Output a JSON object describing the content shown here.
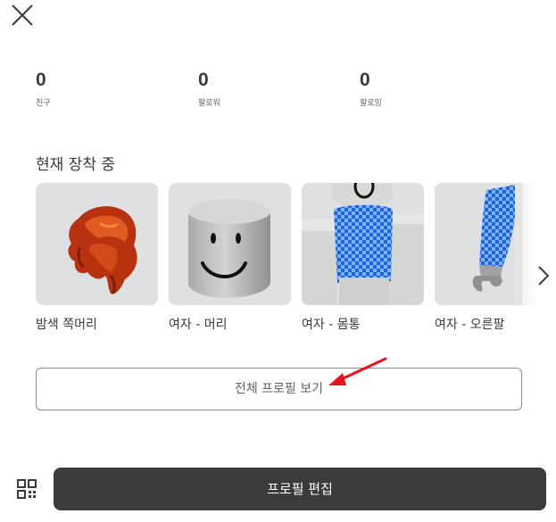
{
  "header": {
    "close_icon": "close-icon"
  },
  "stats": [
    {
      "value": "0",
      "label": "친구"
    },
    {
      "value": "0",
      "label": "팔로워"
    },
    {
      "value": "0",
      "label": "팔로잉"
    }
  ],
  "wearing": {
    "title": "현재 장착 중",
    "items": [
      {
        "name": "밤색 쪽머리",
        "icon": "hair-icon"
      },
      {
        "name": "여자 - 머리",
        "icon": "head-icon"
      },
      {
        "name": "여자 - 몸통",
        "icon": "torso-icon"
      },
      {
        "name": "여자 - 오른팔",
        "icon": "right-arm-icon"
      }
    ],
    "next_icon": "chevron-right-icon"
  },
  "view_full_profile": {
    "label": "전체 프로필 보기",
    "annotation_color": "#e8141e"
  },
  "footer": {
    "qr_icon": "qr-code-icon",
    "edit_profile_label": "프로필 편집",
    "edit_button_color": "#393b3d"
  }
}
